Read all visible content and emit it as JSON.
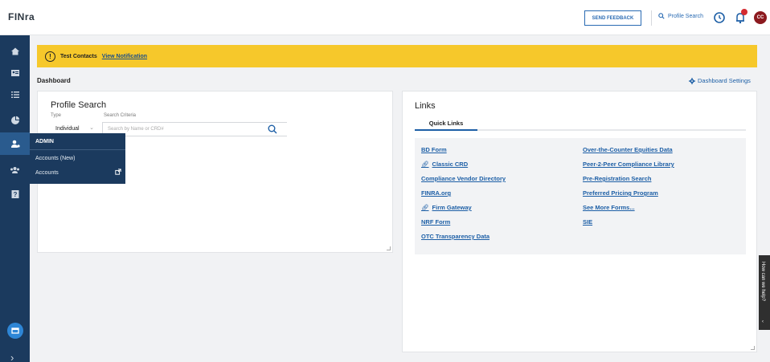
{
  "header": {
    "logo": "FINra",
    "send_feedback": "SEND FEEDBACK",
    "profile_search": "Profile Search",
    "avatar_initials": "CC"
  },
  "admin_menu": {
    "title": "ADMIN",
    "items": [
      {
        "label": "Accounts (New)"
      },
      {
        "label": "Accounts"
      }
    ]
  },
  "banner": {
    "text": "Test Contacts",
    "link": "View Notification"
  },
  "dashboard": {
    "title": "Dashboard",
    "settings": "Dashboard Settings"
  },
  "profile_search_card": {
    "title": "Profile Search",
    "type_label": "Type",
    "criteria_label": "Search Criteria",
    "type_value": "Individual",
    "search_placeholder": "Search by Name or CRD#"
  },
  "links_card": {
    "title": "Links",
    "tab": "Quick Links",
    "left_links": [
      {
        "label": "BD Form",
        "external": false
      },
      {
        "label": "Classic CRD",
        "external": true
      },
      {
        "label": "Compliance Vendor Directory",
        "external": false
      },
      {
        "label": "FINRA.org",
        "external": false
      },
      {
        "label": "Firm Gateway",
        "external": true
      },
      {
        "label": "NRF Form",
        "external": false
      },
      {
        "label": "OTC Transparency Data",
        "external": false
      }
    ],
    "right_links": [
      {
        "label": "Over-the-Counter Equities Data"
      },
      {
        "label": "Peer-2-Peer Compliance Library"
      },
      {
        "label": "Pre-Registration Search"
      },
      {
        "label": "Preferred Pricing Program"
      },
      {
        "label": "See More Forms..."
      },
      {
        "label": "SIE"
      }
    ]
  },
  "help_tab": {
    "text": "How can we help?"
  },
  "colors": {
    "rail": "#1b3a5e",
    "banner": "#f6c82b",
    "link": "#1d5fa6",
    "notification": "#d42b31"
  }
}
